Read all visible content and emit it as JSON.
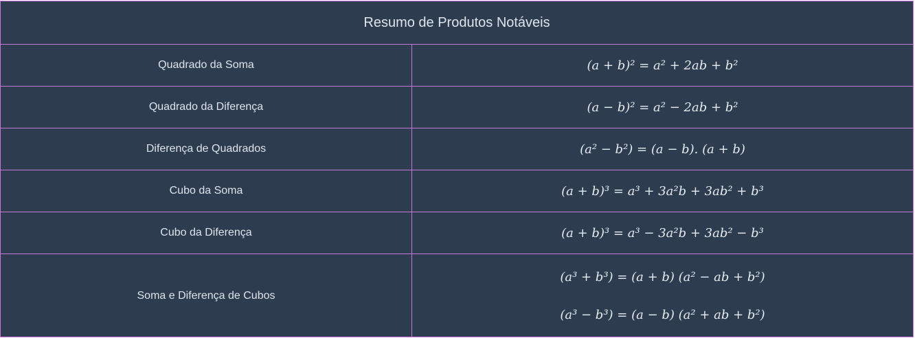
{
  "title": "Resumo de Produtos Notáveis",
  "rows": [
    {
      "name": "Quadrado da Soma",
      "formulas": [
        "(a + b)² = a² + 2ab + b²"
      ]
    },
    {
      "name": "Quadrado da Diferença",
      "formulas": [
        "(a − b)² = a² − 2ab + b²"
      ]
    },
    {
      "name": "Diferença de Quadrados",
      "formulas": [
        "(a² − b²) = (a − b). (a + b)"
      ]
    },
    {
      "name": "Cubo da Soma",
      "formulas": [
        "(a + b)³ = a³ + 3a²b + 3ab² + b³"
      ]
    },
    {
      "name": "Cubo da Diferença",
      "formulas": [
        "(a + b)³ = a³ − 3a²b + 3ab² − b³"
      ]
    },
    {
      "name": "Soma e Diferença de Cubos",
      "formulas": [
        "(a³ + b³) = (a + b) (a² − ab + b²)",
        "(a³ − b³) = (a − b) (a² + ab + b²)"
      ]
    }
  ],
  "colors": {
    "background": "#2d3d4f",
    "border": "#c47ad4",
    "text": "#dde4ec"
  }
}
